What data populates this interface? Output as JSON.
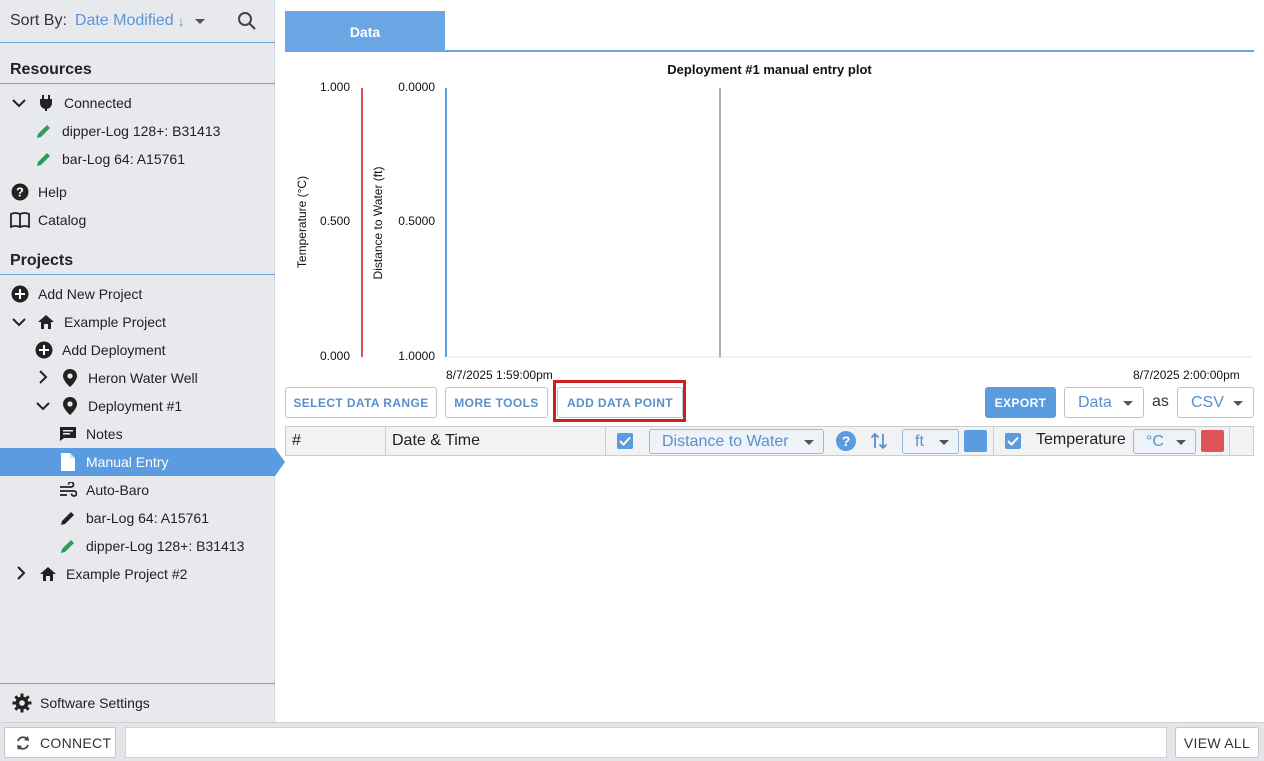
{
  "sidebar": {
    "sort_label": "Sort By:",
    "sort_value": "Date Modified",
    "sort_direction": "↓",
    "resources_title": "Resources",
    "resources": [
      {
        "label": "Connected"
      },
      {
        "label": "dipper-Log 128+: B31413"
      },
      {
        "label": "bar-Log 64: A15761"
      },
      {
        "label": "Help"
      },
      {
        "label": "Catalog"
      }
    ],
    "projects_title": "Projects",
    "projects": [
      {
        "label": "Add New Project"
      },
      {
        "label": "Example Project"
      },
      {
        "label": "Add Deployment"
      },
      {
        "label": "Heron Water Well"
      },
      {
        "label": "Deployment #1"
      },
      {
        "label": "Notes"
      },
      {
        "label": "Manual Entry"
      },
      {
        "label": "Auto-Baro"
      },
      {
        "label": "bar-Log 64: A15761"
      },
      {
        "label": "dipper-Log 128+: B31413"
      },
      {
        "label": "Example Project #2"
      }
    ],
    "settings_label": "Software Settings"
  },
  "bottom": {
    "connect_label": "CONNECT",
    "view_all_label": "VIEW ALL"
  },
  "tabs": [
    {
      "label": "Data",
      "active": true
    }
  ],
  "chart_data": {
    "type": "line",
    "title": "Deployment #1 manual entry plot",
    "y_left": {
      "label": "Temperature (°C)",
      "ticks": [
        "1.000",
        "0.500",
        "0.000"
      ],
      "ylim": [
        0,
        1
      ],
      "color": "#d9534f"
    },
    "y_right": {
      "label": "Distance to Water (ft)",
      "ticks": [
        "0.0000",
        "0.5000",
        "1.0000"
      ],
      "ylim": [
        1,
        0
      ],
      "inverted": true,
      "color": "#5b9be0"
    },
    "x_ticks": [
      "8/7/2025 1:59:00pm",
      "8/7/2025 2:00:00pm"
    ],
    "series": []
  },
  "toolbar": {
    "select_range": "SELECT DATA RANGE",
    "more_tools": "MORE TOOLS",
    "add_point": "ADD DATA POINT",
    "export": "EXPORT",
    "export_what": "Data",
    "as_label": "as",
    "export_format": "CSV"
  },
  "table": {
    "col_num": "#",
    "col_datetime": "Date & Time",
    "col_distance": "Distance to Water",
    "distance_unit": "ft",
    "distance_color": "#5b9be0",
    "col_temperature": "Temperature",
    "temperature_unit": "°C",
    "temperature_color": "#e05457"
  }
}
